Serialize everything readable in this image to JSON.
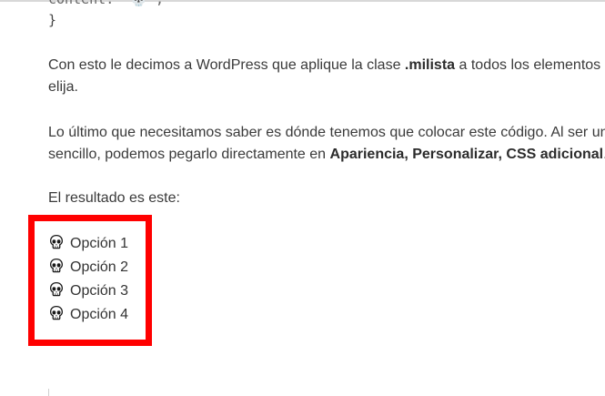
{
  "code": {
    "partial_line": "content: '💀';",
    "closing_brace": "}"
  },
  "paragraph1": {
    "line1_a": "Con esto le decimos a WordPress que aplique la clase ",
    "line1_bold": ".milista",
    "line1_b": " a todos los elementos de",
    "line2": "elija."
  },
  "paragraph2": {
    "line1": "Lo último que necesitamos saber es dónde tenemos que colocar este código. Al ser un c",
    "line2_a": "sencillo, podemos pegarlo directamente en ",
    "line2_bold": "Apariencia, Personalizar, CSS adicional",
    "line2_b": "."
  },
  "paragraph3": {
    "text": "El resultado es este:"
  },
  "result_list": {
    "icon": "skull-icon",
    "items": [
      "Opción 1",
      "Opción 2",
      "Opción 3",
      "Opción 4"
    ]
  },
  "colors": {
    "highlight_border": "#ff0000",
    "text": "#3a3a3a"
  }
}
